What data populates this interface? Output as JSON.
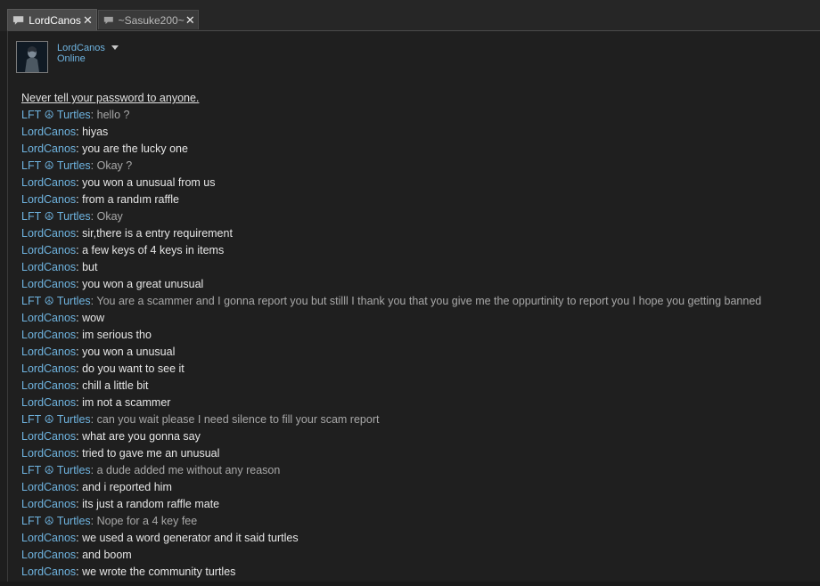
{
  "tabs": [
    {
      "label": "LordCanos",
      "active": true
    },
    {
      "label": "~Sasuke200~",
      "active": false
    }
  ],
  "close_glyph": "✕",
  "header": {
    "name": "LordCanos",
    "status": "Online"
  },
  "warning": "Never tell your password to anyone.",
  "messages": [
    {
      "who": "LFT ☮ Turtles",
      "text": "hello ?",
      "self": false
    },
    {
      "who": "LordCanos",
      "text": "hiyas",
      "self": true
    },
    {
      "who": "LordCanos",
      "text": "you are the lucky one",
      "self": true
    },
    {
      "who": "LFT ☮ Turtles",
      "text": "Okay ?",
      "self": false
    },
    {
      "who": "LordCanos",
      "text": "you won a unusual from us",
      "self": true
    },
    {
      "who": "LordCanos",
      "text": "from a randım raffle",
      "self": true
    },
    {
      "who": "LFT ☮ Turtles",
      "text": "Okay",
      "self": false
    },
    {
      "who": "LordCanos",
      "text": "sir,there is a entry requirement",
      "self": true
    },
    {
      "who": "LordCanos",
      "text": "a few keys of 4 keys in items",
      "self": true
    },
    {
      "who": "LordCanos",
      "text": "but",
      "self": true
    },
    {
      "who": "LordCanos",
      "text": "you won a great unusual",
      "self": true
    },
    {
      "who": "LFT ☮ Turtles",
      "text": "You are a scammer and I gonna report you but stilll I thank you that you give me the oppurtinity to report you I hope you getting banned",
      "self": false
    },
    {
      "who": "LordCanos",
      "text": "wow",
      "self": true
    },
    {
      "who": "LordCanos",
      "text": "im serious tho",
      "self": true
    },
    {
      "who": "LordCanos",
      "text": "you won a unusual",
      "self": true
    },
    {
      "who": "LordCanos",
      "text": "do you want to see it",
      "self": true
    },
    {
      "who": "LordCanos",
      "text": "chill a little bit",
      "self": true
    },
    {
      "who": "LordCanos",
      "text": "im not a scammer",
      "self": true
    },
    {
      "who": "LFT ☮ Turtles",
      "text": "can you wait please I need silence to fill your scam report",
      "self": false
    },
    {
      "who": "LordCanos",
      "text": "what are you gonna say",
      "self": true
    },
    {
      "who": "LordCanos",
      "text": "tried to gave me an unusual",
      "self": true
    },
    {
      "who": "LFT ☮ Turtles",
      "text": "a dude added me without any reason",
      "self": false
    },
    {
      "who": "LordCanos",
      "text": "and i reported him",
      "self": true
    },
    {
      "who": "LordCanos",
      "text": "its just a random raffle mate",
      "self": true
    },
    {
      "who": "LFT ☮ Turtles",
      "text": "Nope for a 4 key fee",
      "self": false
    },
    {
      "who": "LordCanos",
      "text": "we used a word generator and it said turtles",
      "self": true
    },
    {
      "who": "LordCanos",
      "text": "and boom",
      "self": true
    },
    {
      "who": "LordCanos",
      "text": "we wrote the community turtles",
      "self": true
    }
  ]
}
